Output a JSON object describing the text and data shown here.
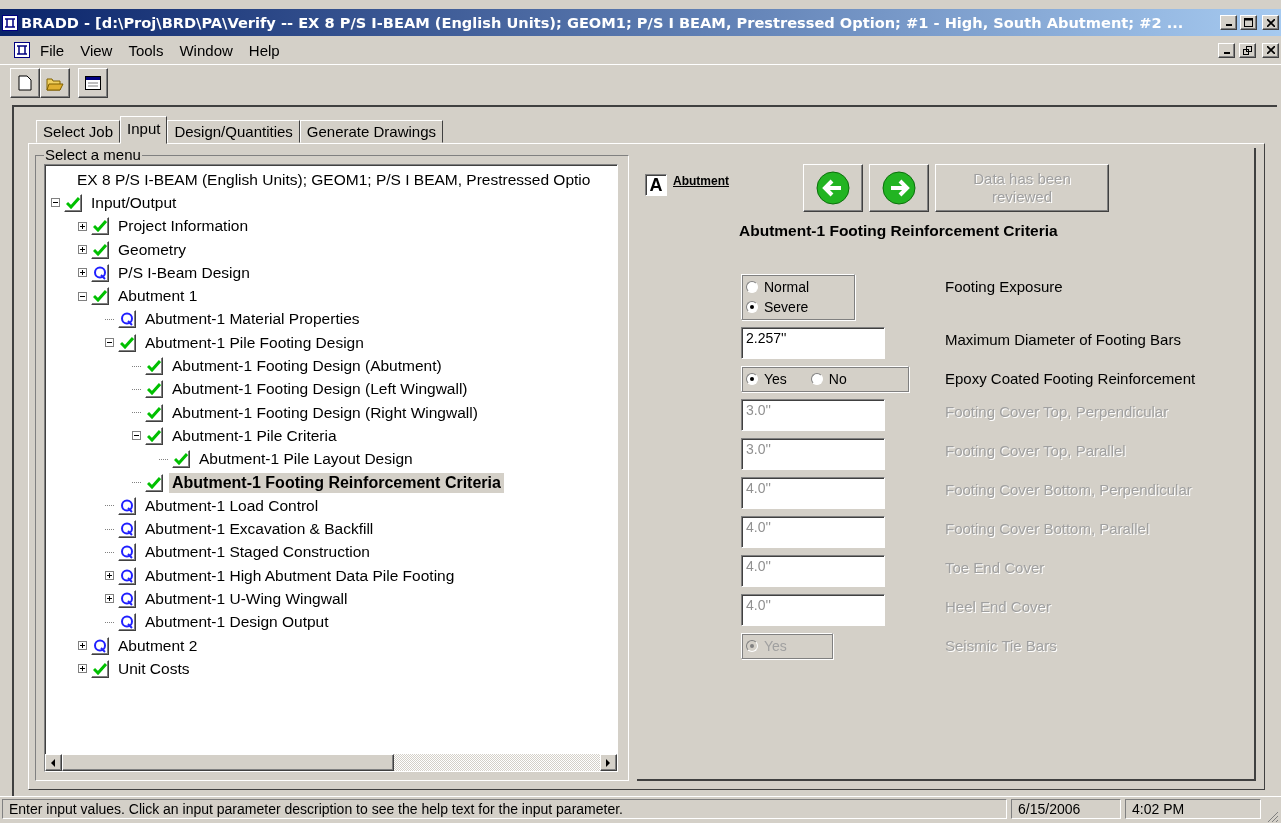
{
  "window": {
    "title": "BRADD - [d:\\Proj\\BRD\\PA\\Verify -- EX 8 P/S I-BEAM (English Units); GEOM1; P/S I BEAM, Prestressed Option; #1 - High, South Abutment; #2 ..."
  },
  "menu": [
    "File",
    "View",
    "Tools",
    "Window",
    "Help"
  ],
  "tabs": [
    {
      "label": "Select Job",
      "selected": false
    },
    {
      "label": "Input",
      "selected": true
    },
    {
      "label": "Design/Quantities",
      "selected": false
    },
    {
      "label": "Generate Drawings",
      "selected": false
    }
  ],
  "tree": {
    "title": "Select a menu",
    "root_label": "EX 8 P/S I-BEAM (English Units); GEOM1; P/S I BEAM, Prestressed Optio",
    "items": [
      {
        "label": "Input/Output",
        "kind": "check",
        "expanded": true,
        "selected": false,
        "children": [
          {
            "label": "Project Information",
            "kind": "check",
            "expanded": false,
            "selected": false
          },
          {
            "label": "Geometry",
            "kind": "check",
            "expanded": false,
            "selected": false
          },
          {
            "label": "P/S I-Beam Design",
            "kind": "q",
            "expanded": false,
            "selected": false
          },
          {
            "label": "Abutment 1",
            "kind": "check",
            "expanded": true,
            "selected": false,
            "children": [
              {
                "label": "Abutment-1 Material Properties",
                "kind": "q",
                "selected": false
              },
              {
                "label": "Abutment-1 Pile Footing Design",
                "kind": "check",
                "expanded": true,
                "selected": false,
                "children": [
                  {
                    "label": "Abutment-1 Footing Design (Abutment)",
                    "kind": "check",
                    "selected": false
                  },
                  {
                    "label": "Abutment-1 Footing Design (Left Wingwall)",
                    "kind": "check",
                    "selected": false
                  },
                  {
                    "label": "Abutment-1 Footing Design (Right Wingwall)",
                    "kind": "check",
                    "selected": false
                  },
                  {
                    "label": "Abutment-1 Pile Criteria",
                    "kind": "check",
                    "expanded": true,
                    "selected": false,
                    "children": [
                      {
                        "label": "Abutment-1 Pile Layout Design",
                        "kind": "check",
                        "selected": false
                      }
                    ]
                  },
                  {
                    "label": "Abutment-1 Footing Reinforcement Criteria",
                    "kind": "check",
                    "selected": true
                  }
                ]
              },
              {
                "label": "Abutment-1 Load Control",
                "kind": "q",
                "selected": false
              },
              {
                "label": "Abutment-1 Excavation & Backfill",
                "kind": "q",
                "selected": false
              },
              {
                "label": "Abutment-1 Staged Construction",
                "kind": "q",
                "selected": false
              },
              {
                "label": "Abutment-1 High Abutment Data Pile Footing",
                "kind": "q",
                "expanded": false,
                "selected": false
              },
              {
                "label": "Abutment-1 U-Wing Wingwall",
                "kind": "q",
                "expanded": false,
                "selected": false
              },
              {
                "label": "Abutment-1 Design Output",
                "kind": "q",
                "selected": false
              }
            ]
          },
          {
            "label": "Abutment 2",
            "kind": "q",
            "expanded": false,
            "selected": false
          },
          {
            "label": "Unit Costs",
            "kind": "check",
            "expanded": false,
            "selected": false
          }
        ]
      }
    ]
  },
  "form": {
    "badge": "A",
    "link": "Abutment",
    "reviewed_button": "Data has been reviewed",
    "heading": "Abutment-1 Footing Reinforcement Criteria",
    "rows": [
      {
        "kind": "radio-group",
        "label": "Footing Exposure",
        "disabled": false,
        "options": [
          {
            "label": "Normal",
            "selected": false
          },
          {
            "label": "Severe",
            "selected": true
          }
        ]
      },
      {
        "kind": "input",
        "label": "Maximum Diameter of Footing Bars",
        "disabled": false,
        "value": "2.257''"
      },
      {
        "kind": "radio-inline",
        "label": "Epoxy Coated Footing Reinforcement",
        "disabled": false,
        "options": [
          {
            "label": "Yes",
            "selected": true
          },
          {
            "label": "No",
            "selected": false
          }
        ]
      },
      {
        "kind": "input",
        "label": "Footing Cover Top, Perpendicular",
        "disabled": true,
        "value": "3.0''"
      },
      {
        "kind": "input",
        "label": "Footing Cover Top, Parallel",
        "disabled": true,
        "value": "3.0''"
      },
      {
        "kind": "input",
        "label": "Footing Cover Bottom, Perpendicular",
        "disabled": true,
        "value": "4.0''"
      },
      {
        "kind": "input",
        "label": "Footing Cover Bottom, Parallel",
        "disabled": true,
        "value": "4.0''"
      },
      {
        "kind": "input",
        "label": "Toe End Cover",
        "disabled": true,
        "value": "4.0''"
      },
      {
        "kind": "input",
        "label": "Heel End Cover",
        "disabled": true,
        "value": "4.0''"
      },
      {
        "kind": "radio-small",
        "label": "Seismic Tie Bars",
        "disabled": true,
        "options": [
          {
            "label": "Yes",
            "selected": true
          }
        ]
      }
    ]
  },
  "status_bar": {
    "message": "Enter input values.  Click an input parameter description to see the help text for the input parameter.",
    "date": "6/15/2006",
    "time": "4:02 PM"
  }
}
